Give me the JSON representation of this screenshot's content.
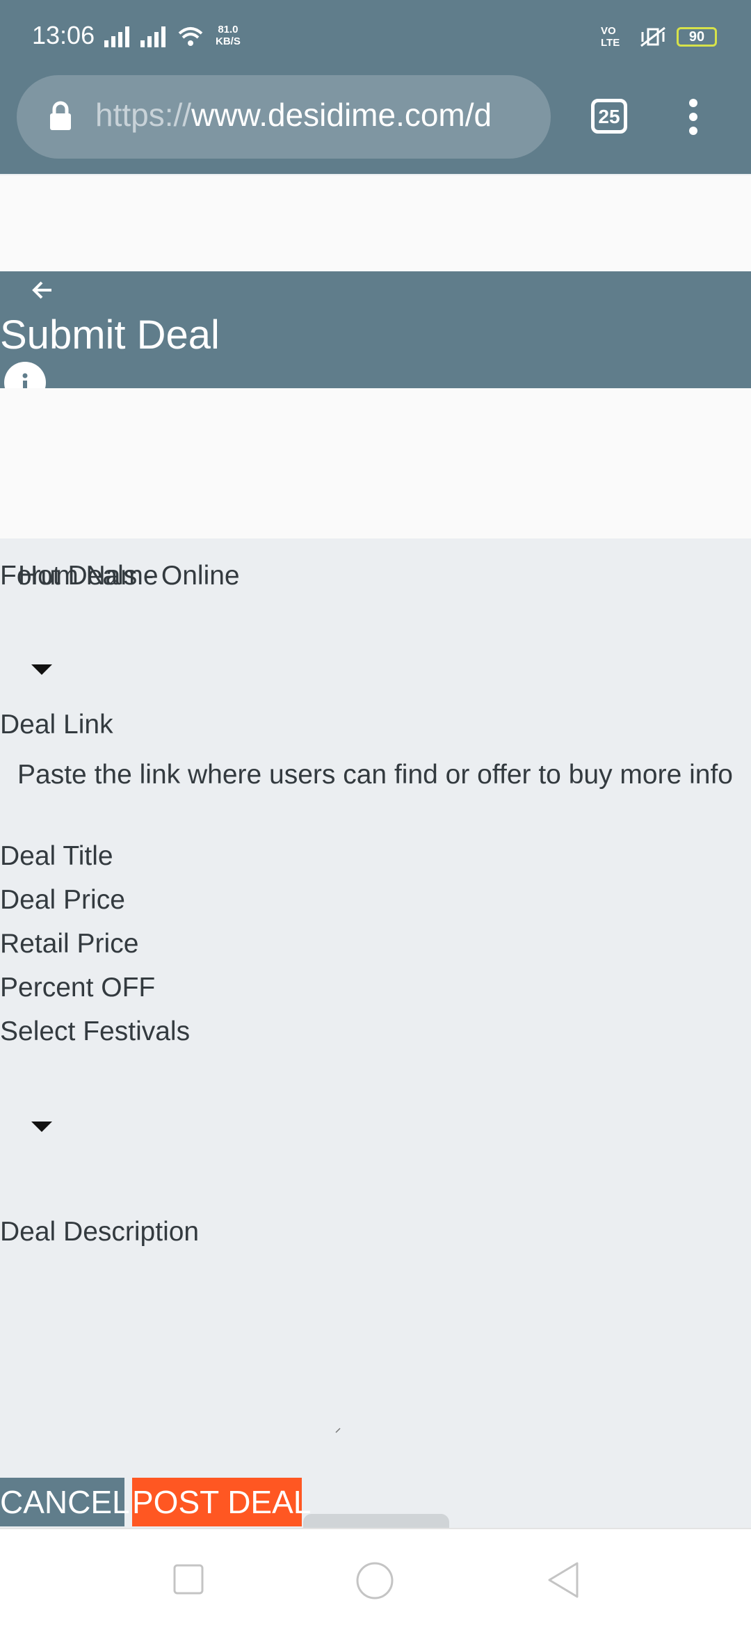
{
  "status_bar": {
    "time": "13:06",
    "net_speed": "81.0\nKB/S",
    "volte": "VO\nLTE",
    "battery": "90"
  },
  "browser": {
    "url_scheme": "https://",
    "url_host": "www.desidime.com/d",
    "tabs_count": "25"
  },
  "header": {
    "title": "Submit Deal"
  },
  "form": {
    "forum_name_label": "Forum Name",
    "forum_name_value": "Hot Deals - Online",
    "deal_link_label": "Deal Link",
    "deal_link_help": "Paste the link where users can find or offer to buy more info",
    "deal_title_label": "Deal Title",
    "deal_price_label": "Deal Price",
    "retail_price_label": "Retail Price",
    "percent_off_label": "Percent OFF",
    "festivals_label": "Select Festivals",
    "description_label": "Deal Description"
  },
  "actions": {
    "cancel_label": "CANCEL",
    "post_label": "POST DEAL"
  },
  "colors": {
    "header_bg": "#607d8b",
    "form_bg": "#ebeef1",
    "post_button": "#ff5722"
  }
}
